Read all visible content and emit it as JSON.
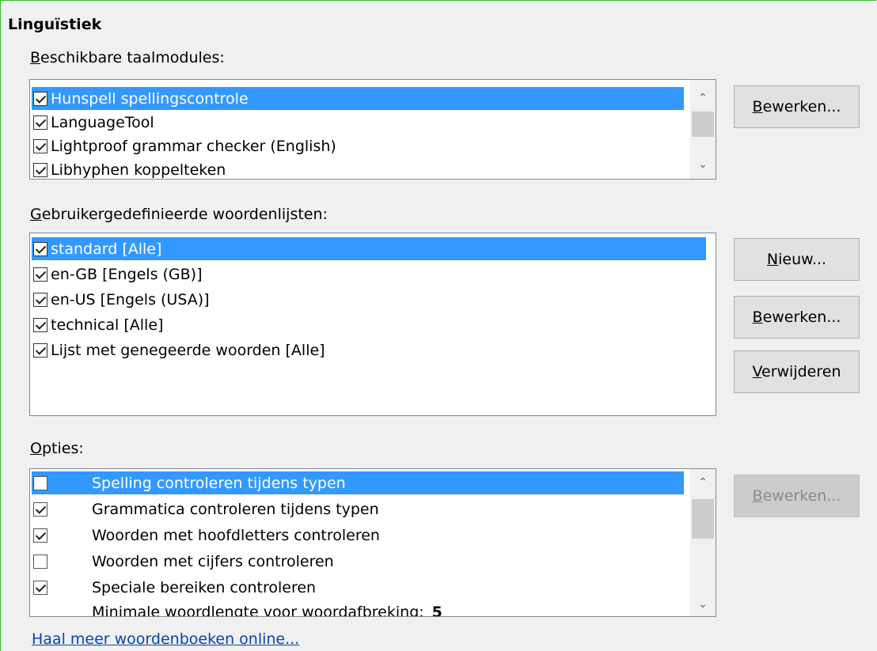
{
  "section_title": "Linguïstiek",
  "modules": {
    "label": "Beschikbare taalmodules:",
    "items": [
      {
        "label": "Hunspell spellingscontrole",
        "checked": true,
        "selected": true
      },
      {
        "label": "LanguageTool",
        "checked": true,
        "selected": false
      },
      {
        "label": "Lightproof grammar checker (English)",
        "checked": true,
        "selected": false
      },
      {
        "label": "Libhyphen koppelteken",
        "checked": true,
        "selected": false
      }
    ],
    "edit_button": "Bewerken..."
  },
  "dictionaries": {
    "label": "Gebruikergedefinieerde woordenlijsten:",
    "items": [
      {
        "label": "standard [Alle]",
        "checked": true,
        "selected": true
      },
      {
        "label": "en-GB [Engels (GB)]",
        "checked": true,
        "selected": false
      },
      {
        "label": "en-US [Engels (USA)]",
        "checked": true,
        "selected": false
      },
      {
        "label": "technical [Alle]",
        "checked": true,
        "selected": false
      },
      {
        "label": "Lijst met genegeerde woorden [Alle]",
        "checked": true,
        "selected": false
      }
    ],
    "new_button": "Nieuw...",
    "edit_button": "Bewerken...",
    "delete_button": "Verwijderen"
  },
  "options": {
    "label": "Opties:",
    "items": [
      {
        "label": "Spelling controleren tijdens typen",
        "checked": false,
        "selected": true
      },
      {
        "label": "Grammatica controleren tijdens typen",
        "checked": true,
        "selected": false
      },
      {
        "label": "Woorden met hoofdletters controleren",
        "checked": true,
        "selected": false
      },
      {
        "label": "Woorden met cijfers controleren",
        "checked": false,
        "selected": false
      },
      {
        "label": "Speciale bereiken controleren",
        "checked": true,
        "selected": false
      },
      {
        "label": "Minimale woordlengte voor woordafbreking:",
        "value": "5",
        "checkbox": false
      }
    ],
    "edit_button": "Bewerken..."
  },
  "more_dictionaries_link": "Haal meer woordenboeken online..."
}
